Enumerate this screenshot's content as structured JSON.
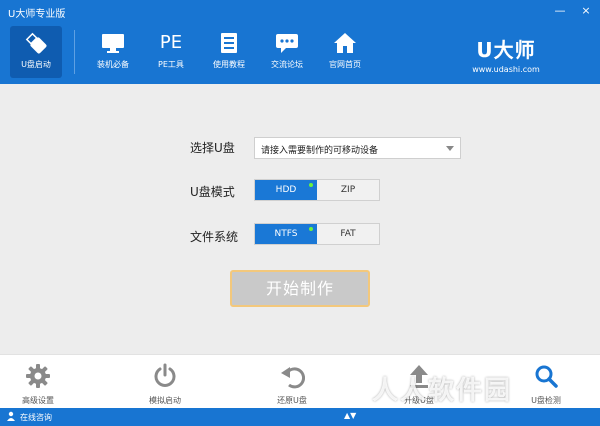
{
  "app": {
    "title": "U大师专业版"
  },
  "window": {
    "minimize": "—",
    "close": "×"
  },
  "nav": {
    "items": [
      {
        "id": "u-boot",
        "label": "U盘启动",
        "icon": "usb-icon",
        "active": true
      },
      {
        "id": "install",
        "label": "装机必备",
        "icon": "monitor-icon"
      },
      {
        "id": "pe",
        "label": "PE工具",
        "icon": "pe-icon",
        "text": "PE"
      },
      {
        "id": "tutorial",
        "label": "使用教程",
        "icon": "book-icon"
      },
      {
        "id": "forum",
        "label": "交流论坛",
        "icon": "chat-icon"
      },
      {
        "id": "home",
        "label": "官网首页",
        "icon": "home-icon"
      }
    ]
  },
  "brand": {
    "name": "U大师",
    "url": "www.udashi.com"
  },
  "form": {
    "device_label": "选择U盘",
    "device_value": "请接入需要制作的可移动设备",
    "mode_label": "U盘模式",
    "mode_options": [
      "HDD",
      "ZIP"
    ],
    "mode_selected": "HDD",
    "fs_label": "文件系统",
    "fs_options": [
      "NTFS",
      "FAT"
    ],
    "fs_selected": "NTFS",
    "start_label": "开始制作"
  },
  "toolbar": {
    "items": [
      {
        "label": "高级设置",
        "icon": "gear-icon"
      },
      {
        "label": "模拟启动",
        "icon": "power-icon"
      },
      {
        "label": "还原U盘",
        "icon": "undo-icon"
      },
      {
        "label": "升级U盘",
        "icon": "upload-icon"
      },
      {
        "label": "U盘检测",
        "icon": "search-icon"
      }
    ]
  },
  "status": {
    "consult": "在线咨询",
    "mid": "▲▼"
  },
  "watermark": "人人软件园",
  "colors": {
    "primary": "#1875d2",
    "active": "#0f5cb0",
    "toggle_on": "#1a78d6",
    "dot": "#6cf23a"
  }
}
